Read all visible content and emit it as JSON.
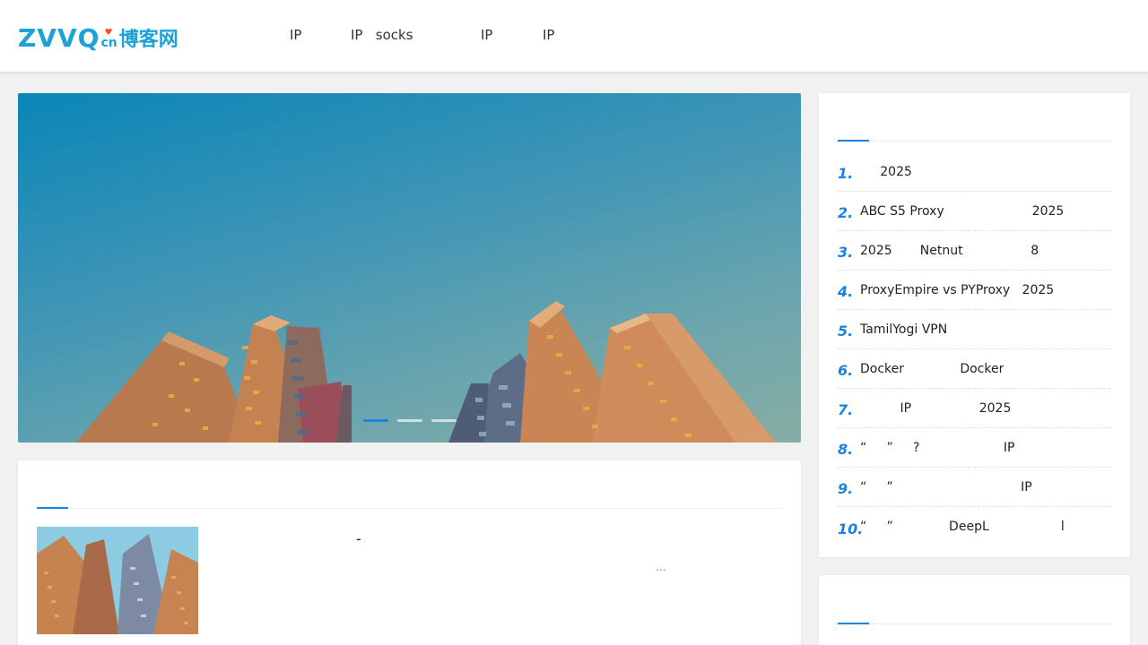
{
  "site": {
    "logo_main": "ZVVQ",
    "logo_tld": "cn",
    "logo_cn": "博客网",
    "brand_color": "#1aa3d6",
    "accent_color": "#1a82e2",
    "heart_color": "#f0512a"
  },
  "nav": {
    "items": [
      {
        "label": "IP"
      },
      {
        "label": "IP   socks"
      },
      {
        "label": "IP"
      },
      {
        "label": "IP"
      }
    ]
  },
  "hero": {
    "slide_count": 3,
    "active_slide": 1
  },
  "latest": {
    "post_title": "-",
    "post_excerpt": "..."
  },
  "hot_posts": {
    "items": [
      {
        "num": "1.",
        "text": "     2025"
      },
      {
        "num": "2.",
        "text": "ABC S5 Proxy                      2025"
      },
      {
        "num": "3.",
        "text": "2025       Netnut                 8"
      },
      {
        "num": "4.",
        "text": "ProxyEmpire vs PYProxy   2025"
      },
      {
        "num": "5.",
        "text": "TamilYogi VPN"
      },
      {
        "num": "6.",
        "text": "Docker              Docker"
      },
      {
        "num": "7.",
        "text": "          IP                 2025"
      },
      {
        "num": "8.",
        "text": "“     ”     ?                     IP"
      },
      {
        "num": "9.",
        "text": "“     ”                                IP"
      },
      {
        "num": "10.",
        "text": "“     ”              DeepL                  l"
      }
    ]
  }
}
